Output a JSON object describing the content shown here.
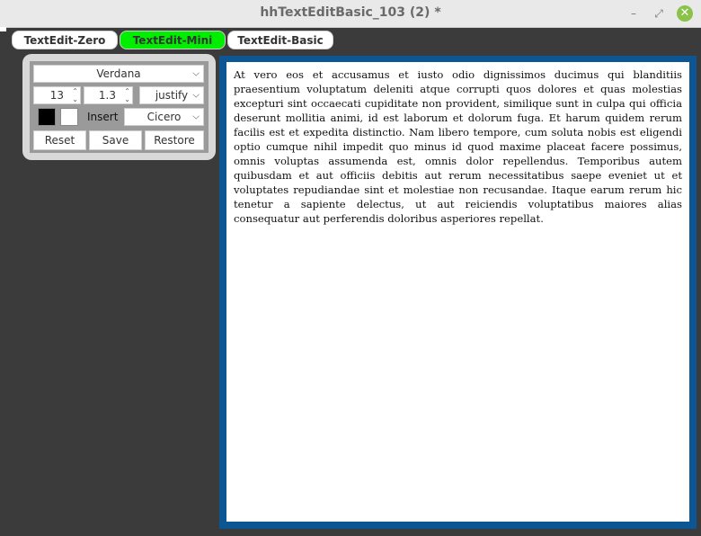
{
  "window": {
    "title": "hhTextEditBasic_103 (2) *",
    "controls": {
      "minimize": "–",
      "maximize": "⤢",
      "close": "✕"
    }
  },
  "tabs": [
    {
      "label": "TextEdit-Zero",
      "active": false
    },
    {
      "label": "TextEdit-Mini",
      "active": true
    },
    {
      "label": "TextEdit-Basic",
      "active": false
    }
  ],
  "toolbar": {
    "font_family": "Verdana",
    "font_size": "13",
    "line_height": "1.3",
    "alignment": "justify",
    "text_color": "#000000",
    "background_color": "#ffffff",
    "insert_label": "Insert",
    "insert_option": "Cicero",
    "reset_label": "Reset",
    "save_label": "Save",
    "restore_label": "Restore"
  },
  "editor": {
    "text": "At vero eos et accusamus et iusto odio dignissimos ducimus qui blanditiis praesentium voluptatum deleniti atque corrupti quos dolores et quas molestias excepturi sint occaecati cupiditate non provident, similique sunt in culpa qui officia deserunt mollitia animi, id est laborum et dolorum fuga. Et harum quidem rerum facilis est et expedita distinctio. Nam libero tempore, cum soluta nobis est eligendi optio cumque nihil impedit quo minus id quod maxime placeat facere possimus, omnis voluptas assumenda est, omnis dolor repellendus. Temporibus autem quibusdam et aut officiis debitis aut rerum necessitatibus saepe eveniet ut et voluptates repudiandae sint et molestiae non recusandae. Itaque earum rerum hic tenetur a sapiente delectus, ut aut reiciendis voluptatibus maiores alias consequatur aut perferendis doloribus asperiores repellat."
  },
  "colors": {
    "active_tab": "#00ee00",
    "editor_border": "#0c5694",
    "background": "#3b3b3b"
  }
}
